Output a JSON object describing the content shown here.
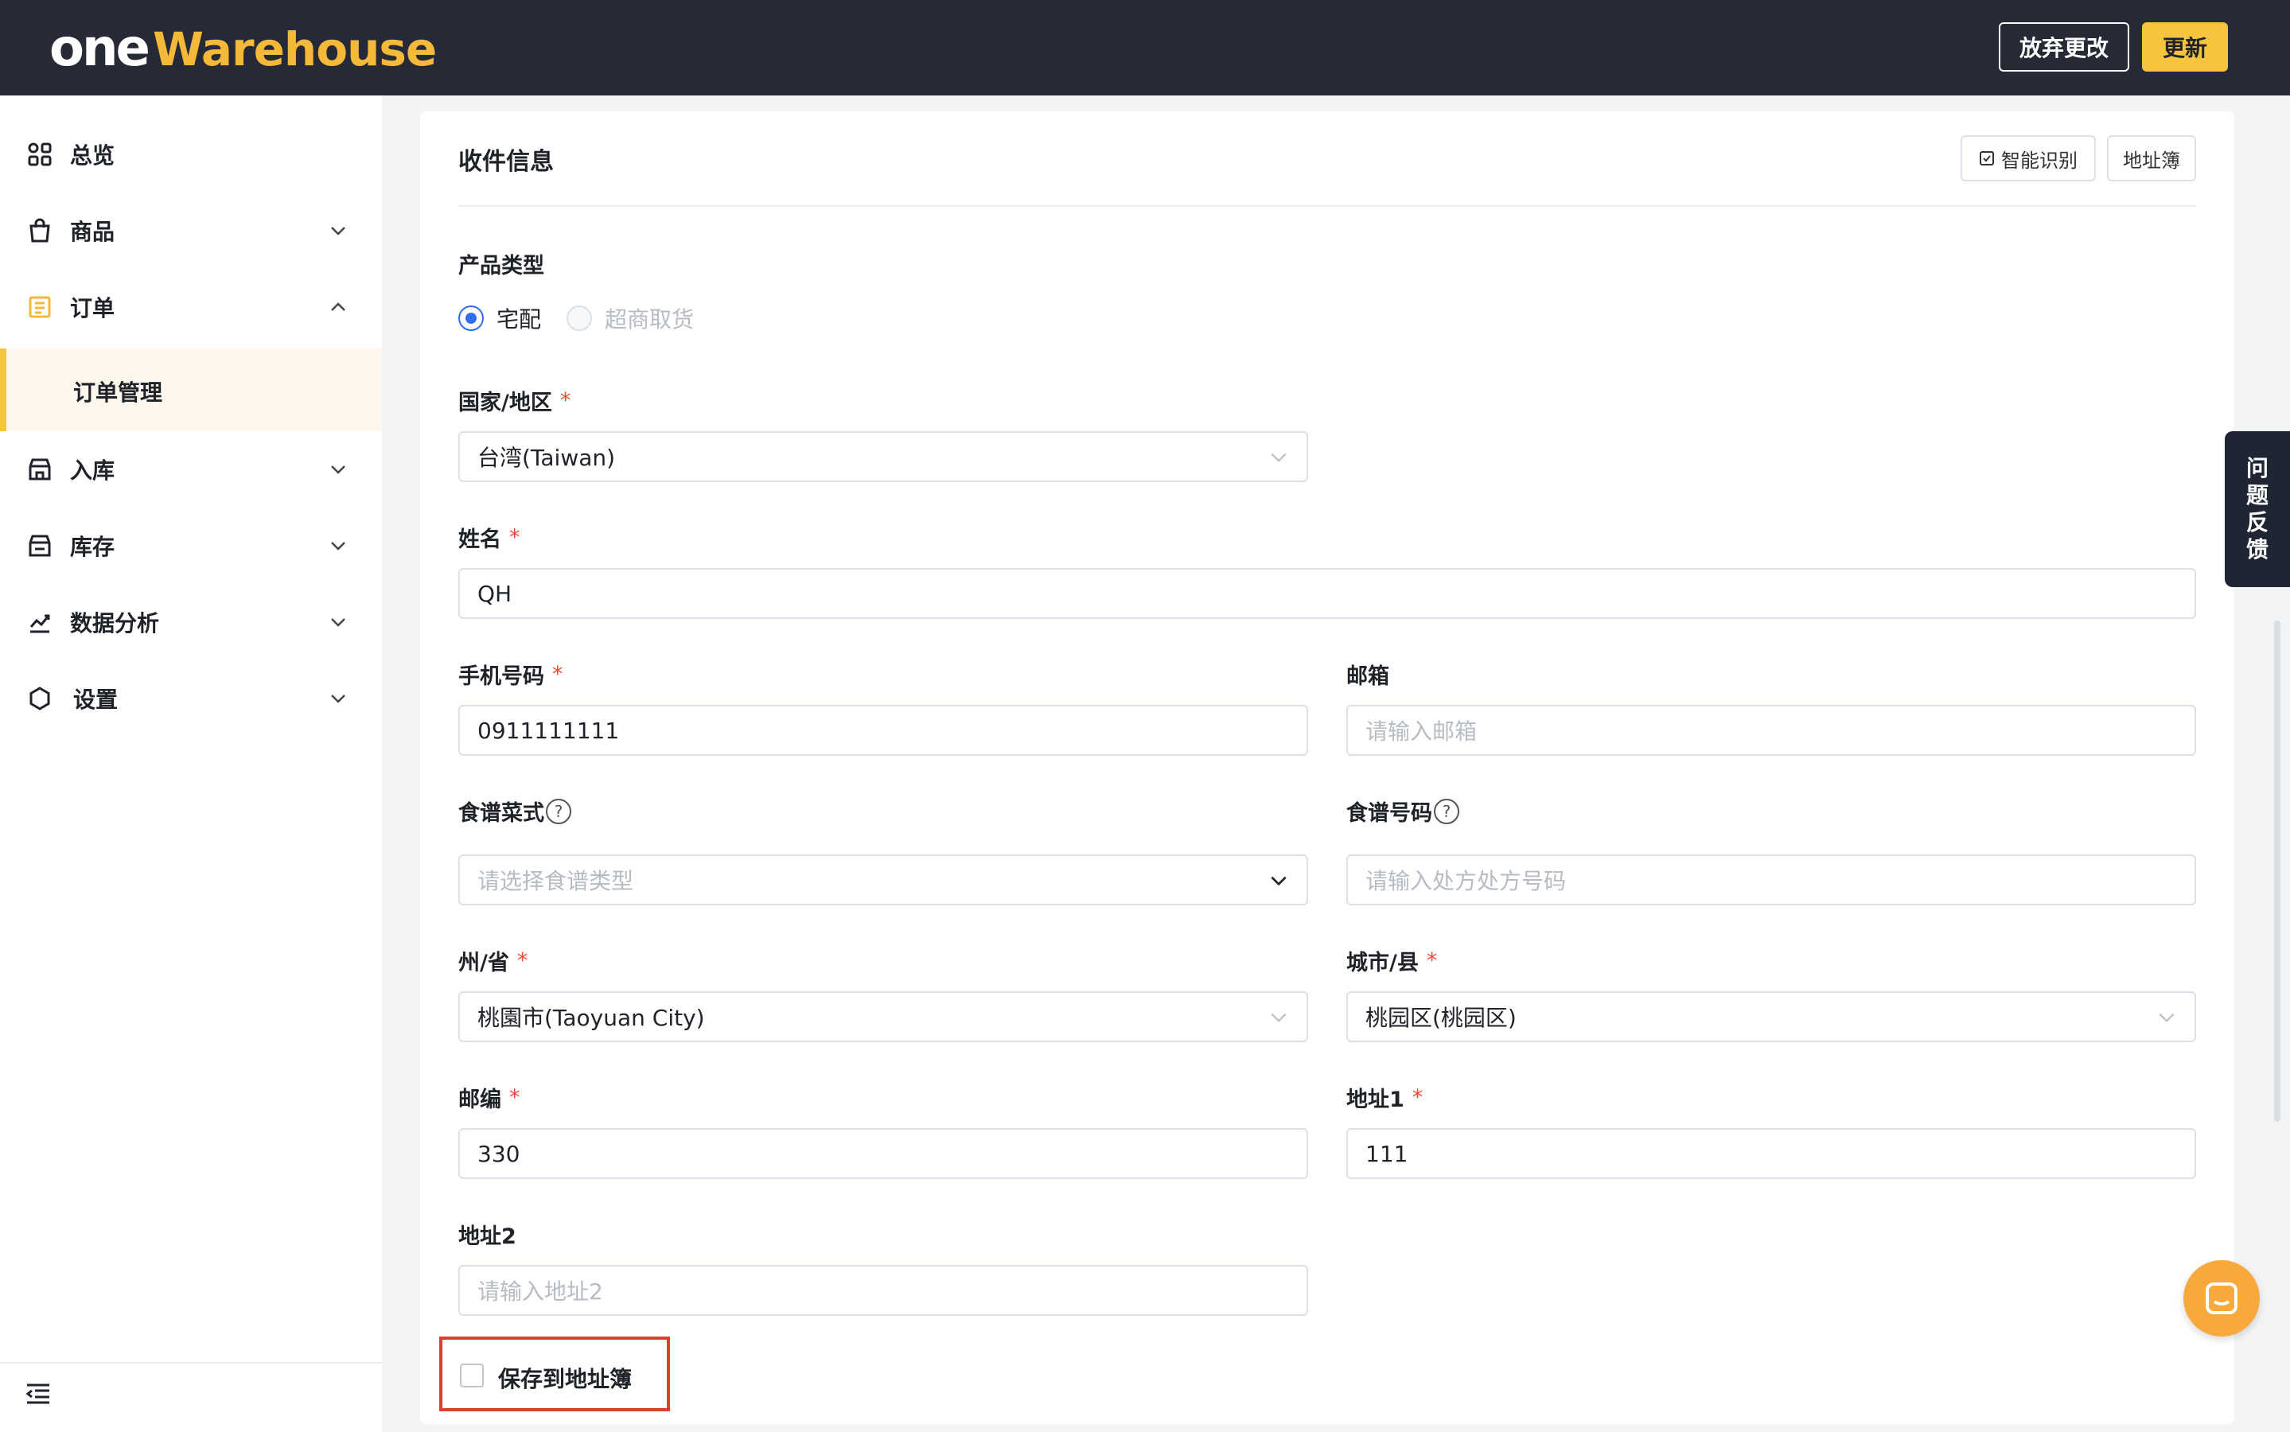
{
  "header": {
    "logo_one": "one",
    "logo_warehouse": "Warehouse",
    "discard_label": "放弃更改",
    "update_label": "更新"
  },
  "sidebar": {
    "items": [
      {
        "label": "总览",
        "icon": "dashboard-icon"
      },
      {
        "label": "商品",
        "icon": "shopping-bag-icon"
      },
      {
        "label": "订单",
        "icon": "order-icon"
      },
      {
        "label": "订单管理"
      },
      {
        "label": "入库",
        "icon": "inbound-icon"
      },
      {
        "label": "库存",
        "icon": "warehouse-icon"
      },
      {
        "label": "数据分析",
        "icon": "chart-icon"
      },
      {
        "label": "设置",
        "icon": "settings-icon"
      }
    ]
  },
  "form": {
    "title": "收件信息",
    "smart_label": "智能识别",
    "addressbook_label": "地址簿",
    "product_type_label": "产品类型",
    "radio_home": "宅配",
    "radio_store": "超商取货",
    "country_label": "国家/地区",
    "country_value": "台湾(Taiwan)",
    "name_label": "姓名",
    "name_value": "QH",
    "phone_label": "手机号码",
    "phone_value": "0911111111",
    "email_label": "邮箱",
    "email_placeholder": "请输入邮箱",
    "recipe_type_label": "食谱菜式",
    "recipe_type_placeholder": "请选择食谱类型",
    "recipe_no_label": "食谱号码",
    "recipe_no_placeholder": "请输入处方处方号码",
    "state_label": "州/省",
    "state_value": "桃園市(Taoyuan City)",
    "city_label": "城市/县",
    "city_value": "桃园区(桃园区)",
    "zip_label": "邮编",
    "zip_value": "330",
    "addr1_label": "地址1",
    "addr1_value": "111",
    "addr2_label": "地址2",
    "addr2_placeholder": "请输入地址2",
    "save_label": "保存到地址簿",
    "required_mark": "*",
    "help_mark": "?"
  },
  "feedback": {
    "chars": [
      "问",
      "题",
      "反",
      "馈"
    ]
  },
  "colors": {
    "header_bg": "#262a36",
    "accent": "#f8c43d",
    "primary": "#2f6df6",
    "required": "#f04b3c"
  }
}
